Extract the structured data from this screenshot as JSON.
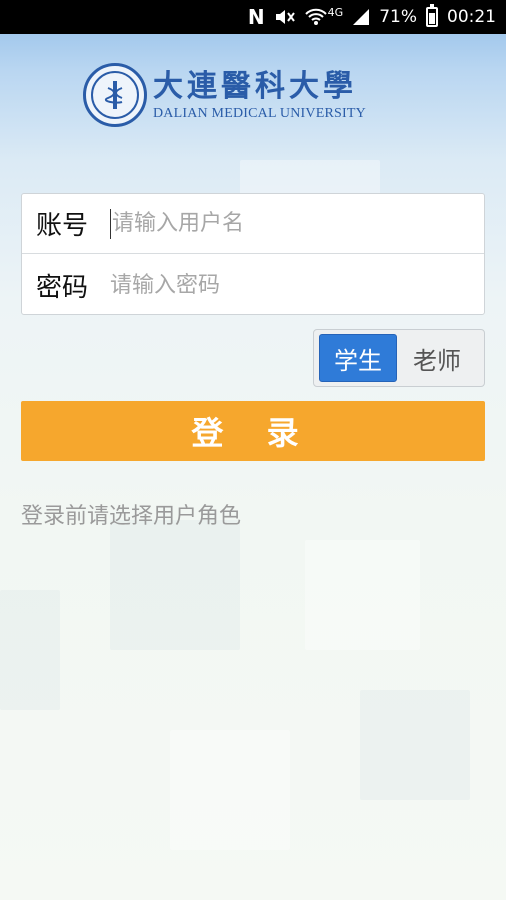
{
  "status_bar": {
    "battery": "71%",
    "time": "00:21",
    "network": "4G",
    "icons": [
      "n-icon",
      "mute-icon",
      "wifi-icon",
      "signal-icon",
      "battery-icon"
    ]
  },
  "logo": {
    "name_cn": "大連醫科大學",
    "name_en": "DALIAN MEDICAL UNIVERSITY"
  },
  "form": {
    "account_label": "账号",
    "account_placeholder": "请输入用户名",
    "account_value": "",
    "password_label": "密码",
    "password_placeholder": "请输入密码",
    "password_value": ""
  },
  "roles": {
    "selected": "学生",
    "student": "学生",
    "teacher": "老师"
  },
  "login_button": "登 录",
  "hint": "登录前请选择用户角色",
  "colors": {
    "accent_orange": "#f6a72d",
    "selected_blue": "#2f7bd8",
    "brand_blue": "#2a5ca8"
  }
}
